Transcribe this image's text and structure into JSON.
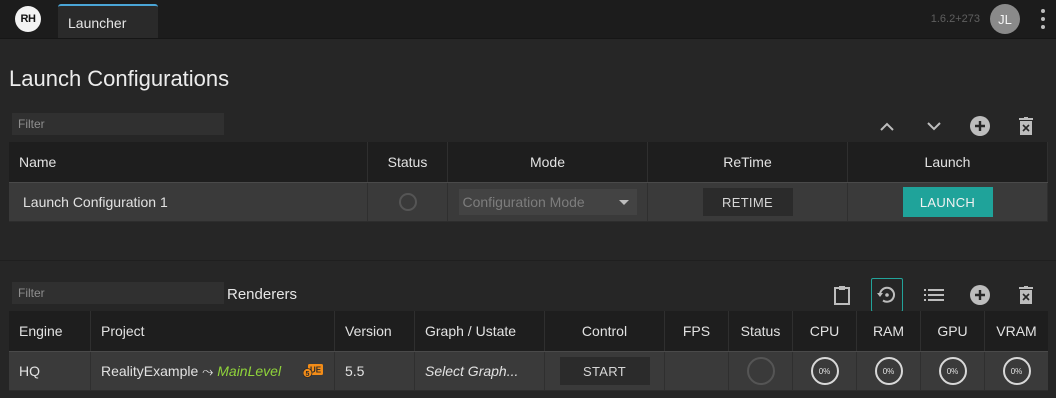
{
  "app": {
    "logo_text": "RH",
    "tab_label": "Launcher",
    "version": "1.6.2+273",
    "user_initials": "JL",
    "accent": "#22a39a",
    "tab_accent": "#4aa5d6"
  },
  "launch_configs": {
    "title": "Launch Configurations",
    "filter_placeholder": "Filter",
    "toolbar_icons": [
      "chevron-up-icon",
      "chevron-down-icon",
      "add-circle-icon",
      "delete-icon"
    ],
    "columns": [
      "Name",
      "Status",
      "Mode",
      "ReTime",
      "Launch"
    ],
    "rows": [
      {
        "name": "Launch Configuration 1",
        "mode_placeholder": "Configuration Mode",
        "retime_label": "RETIME",
        "launch_label": "LAUNCH"
      }
    ]
  },
  "renderers": {
    "title": "Renderers",
    "filter_placeholder": "Filter",
    "toolbar_icons": [
      "clipboard-icon",
      "restore-icon",
      "list-icon",
      "add-circle-icon",
      "delete-icon"
    ],
    "columns": [
      "Engine",
      "Project",
      "Version",
      "Graph / Ustate",
      "Control",
      "FPS",
      "Status",
      "CPU",
      "RAM",
      "GPU",
      "VRAM"
    ],
    "rows": [
      {
        "engine": "HQ",
        "project": "RealityExample",
        "project_arrow": "⤳",
        "level": "MainLevel",
        "badge_text": "UE",
        "badge_number": "5",
        "version": "5.5",
        "graph": "Select Graph...",
        "control_label": "START",
        "fps": "",
        "cpu": "0%",
        "ram": "0%",
        "gpu": "0%",
        "vram": "0%"
      }
    ]
  }
}
